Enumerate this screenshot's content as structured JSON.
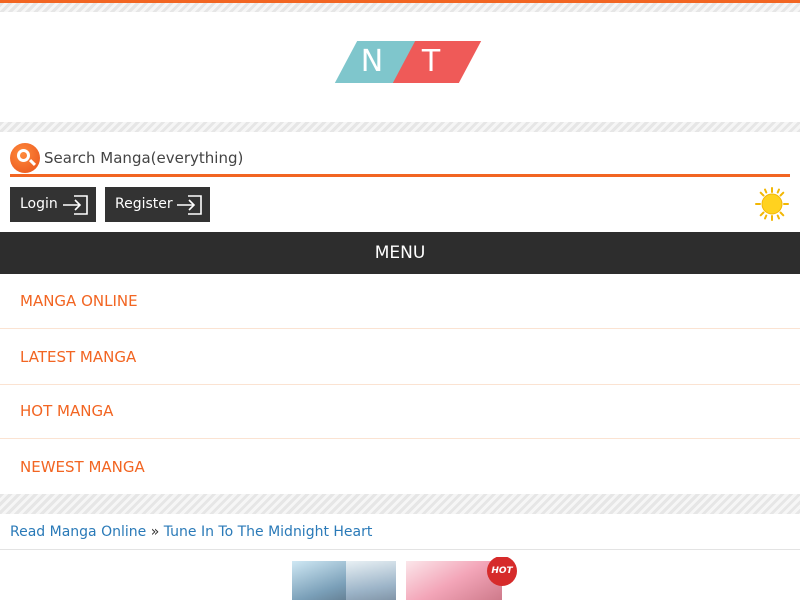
{
  "logo": {
    "left_letter": "N",
    "right_letter": "T"
  },
  "search": {
    "placeholder": "Search Manga(everything)",
    "value": ""
  },
  "auth": {
    "login_label": "Login",
    "register_label": "Register"
  },
  "menu": {
    "header": "MENU",
    "items": [
      {
        "label": "MANGA ONLINE"
      },
      {
        "label": "LATEST MANGA"
      },
      {
        "label": "HOT MANGA"
      },
      {
        "label": "NEWEST MANGA"
      }
    ]
  },
  "breadcrumb": {
    "home": "Read Manga Online",
    "separator": "»",
    "current": "Tune In To The Midnight Heart"
  },
  "cover": {
    "badge": "HOT"
  },
  "colors": {
    "accent": "#f26522",
    "dark": "#2d2d2d",
    "link": "#2a7ab8",
    "logo_teal": "#7fc6cc",
    "logo_red": "#ef5a58"
  },
  "icons": {
    "search": "search-icon",
    "login": "login-arrow-icon",
    "register": "register-arrow-icon",
    "theme": "sun-icon"
  }
}
